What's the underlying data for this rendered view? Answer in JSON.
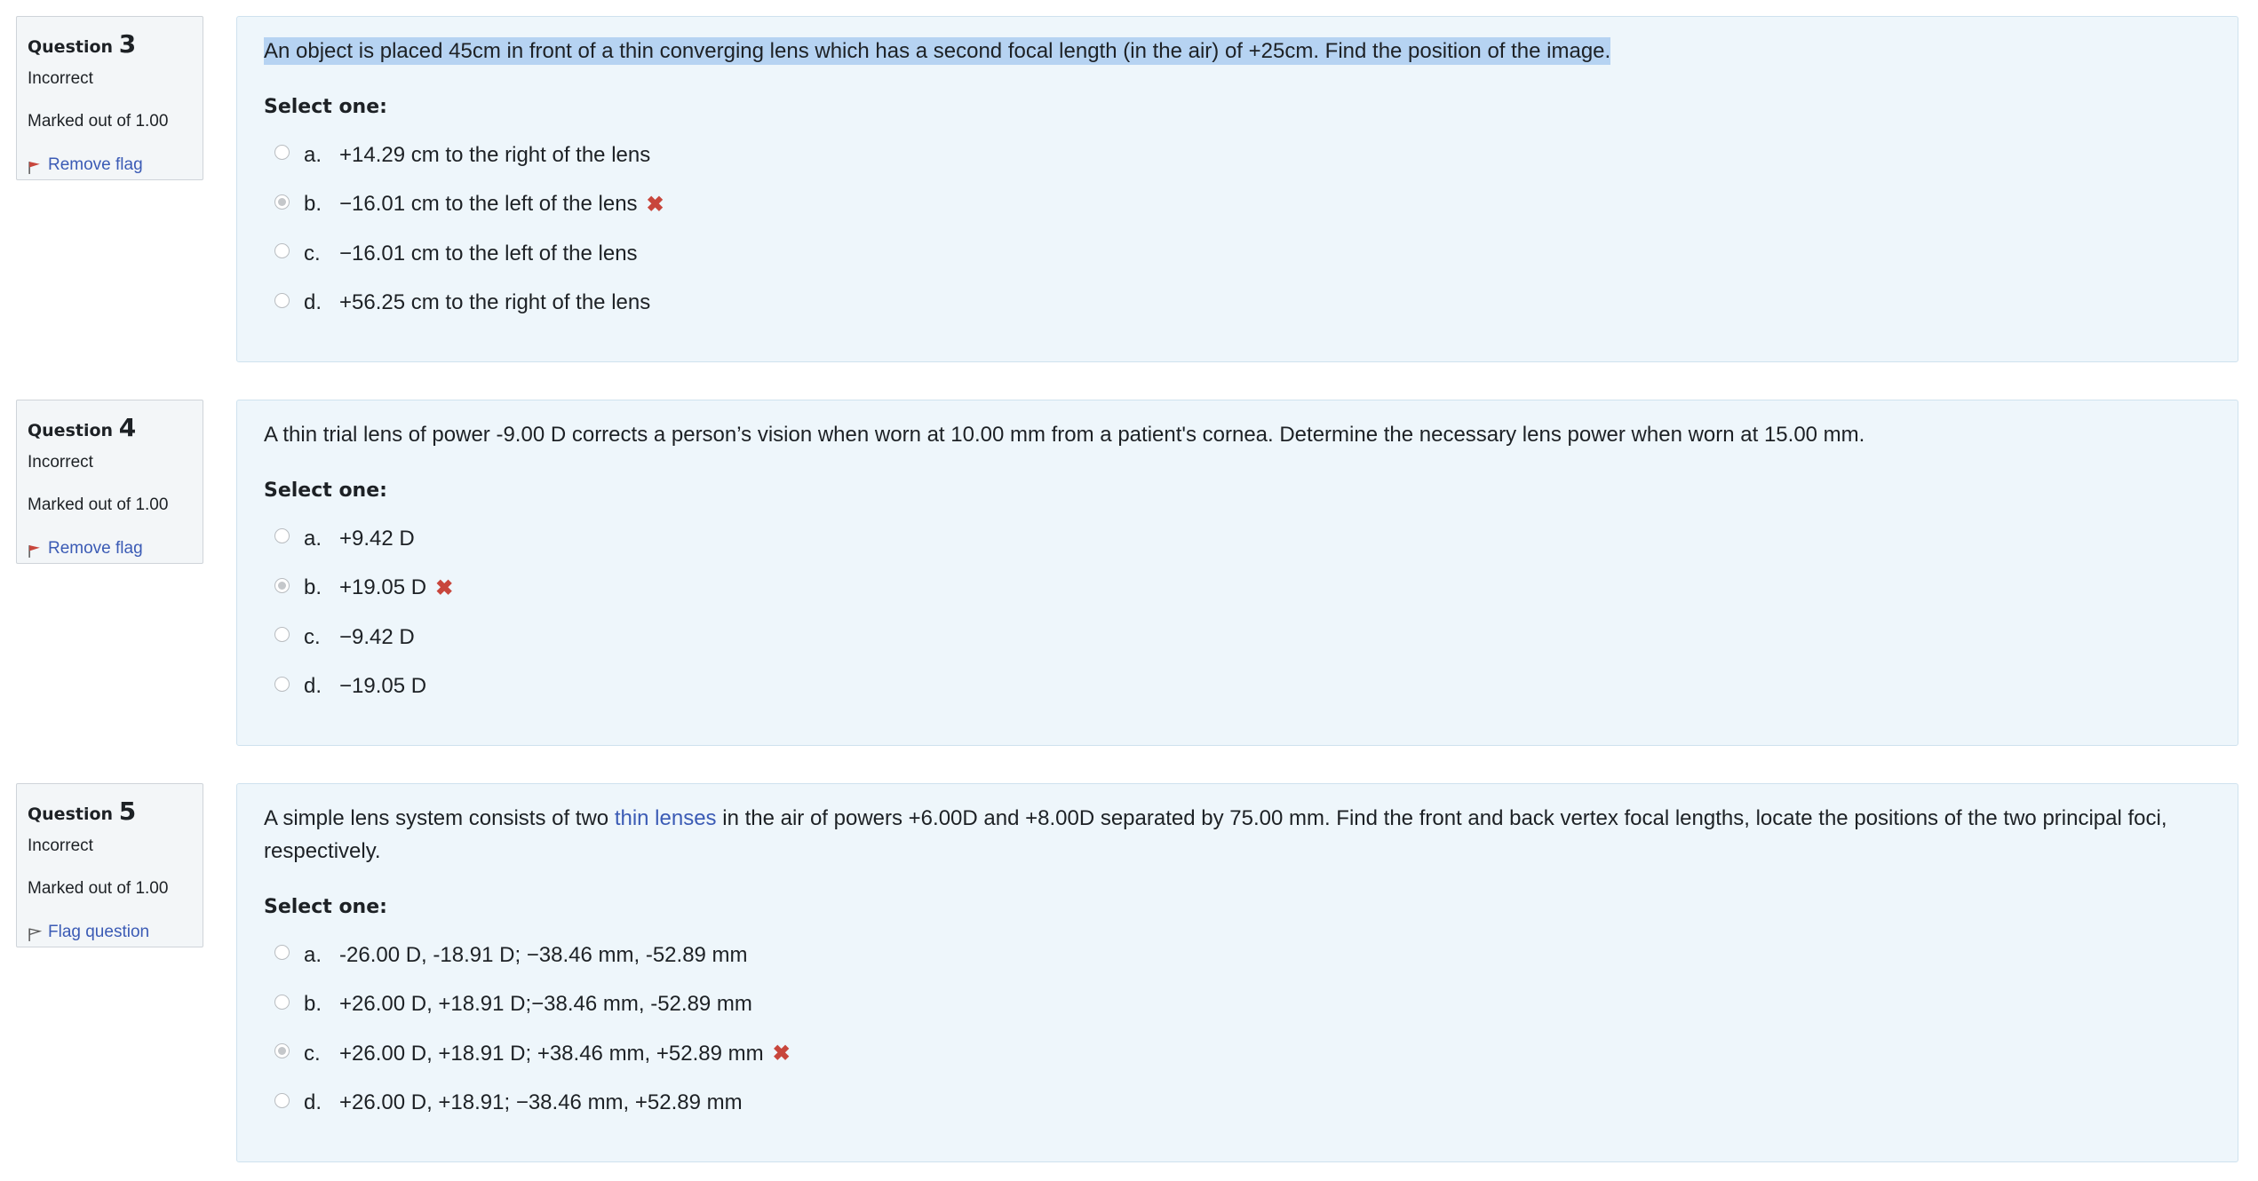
{
  "questions": [
    {
      "label": "Question",
      "number": "3",
      "state": "Incorrect",
      "grade": "Marked out of 1.00",
      "flag_label": "Remove flag",
      "text": "An object is placed 45cm in front of a thin converging lens which has a second focal length (in the air) of +25cm. Find the position of the image.",
      "prompt": "Select one:",
      "answers": [
        {
          "letter": "a.",
          "text": "+14.29 cm to the right of the lens"
        },
        {
          "letter": "b.",
          "text": "−16.01 cm to the left of the lens"
        },
        {
          "letter": "c.",
          "text": "−16.01 cm to the left of the lens"
        },
        {
          "letter": "d.",
          "text": "+56.25 cm to the right of the lens"
        }
      ]
    },
    {
      "label": "Question",
      "number": "4",
      "state": "Incorrect",
      "grade": "Marked out of 1.00",
      "flag_label": "Remove flag",
      "text": "A thin trial lens of power -9.00 D corrects a person’s vision when worn at 10.00 mm from a patient's cornea.  Determine the necessary lens power when worn at 15.00 mm.",
      "prompt": "Select one:",
      "answers": [
        {
          "letter": "a.",
          "text": "+9.42 D"
        },
        {
          "letter": "b.",
          "text": "+19.05 D"
        },
        {
          "letter": "c.",
          "text": "−9.42 D"
        },
        {
          "letter": "d.",
          "text": "−19.05 D"
        }
      ]
    },
    {
      "label": "Question",
      "number": "5",
      "state": "Incorrect",
      "grade": "Marked out of 1.00",
      "flag_label": "Flag question",
      "text_before": "A simple lens system consists of two ",
      "text_link": "thin lenses",
      "text_after": " in the air of powers +6.00D and +8.00D separated by 75.00 mm. Find the front and back vertex focal lengths, locate the positions of the two principal foci, respectively.",
      "prompt": "Select one:",
      "answers": [
        {
          "letter": "a.",
          "text": "-26.00 D, -18.91 D; −38.46 mm, -52.89 mm"
        },
        {
          "letter": "b.",
          "text": "+26.00 D, +18.91 D;−38.46 mm, -52.89 mm"
        },
        {
          "letter": "c.",
          "text": "+26.00 D, +18.91 D; +38.46 mm, +52.89 mm"
        },
        {
          "letter": "d.",
          "text": "+26.00 D, +18.91; −38.46 mm, +52.89 mm"
        }
      ]
    }
  ],
  "colors": {
    "link": "#3b5bb5",
    "incorrect_mark": "#c8463c",
    "panel_bg": "#eef6fb",
    "info_bg": "#f3f6f8",
    "highlight": "#b6d3f2",
    "flag_red": "#c8463c"
  },
  "icons": {
    "flag_set": "red-flag-icon",
    "flag_unset": "outline-flag-icon",
    "incorrect": "cross-icon"
  }
}
